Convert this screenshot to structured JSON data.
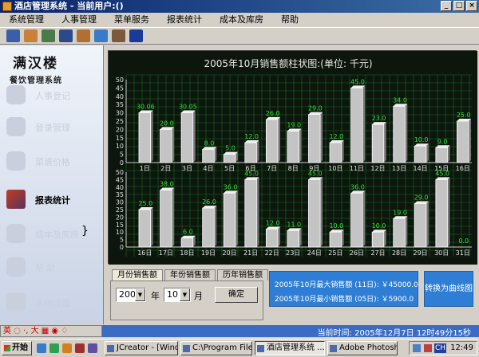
{
  "window": {
    "title": "酒店管理系统 - 当前用户:()"
  },
  "menu": [
    "系统管理",
    "人事管理",
    "菜单服务",
    "报表统计",
    "成本及库房",
    "帮助"
  ],
  "toolbar": [
    {
      "icon": "report-icon",
      "color": "#3a5fa8"
    },
    {
      "icon": "users-icon",
      "color": "#c8803a"
    },
    {
      "icon": "gear-icon",
      "color": "#4a7a4a"
    },
    {
      "icon": "book-icon",
      "color": "#2a4a8a"
    },
    {
      "icon": "folder-icon",
      "color": "#b07030"
    },
    {
      "icon": "plane-icon",
      "color": "#3a7ac8"
    },
    {
      "icon": "pen-icon",
      "color": "#7a5a3a"
    },
    {
      "icon": "info-icon",
      "color": "#1a3a9a"
    }
  ],
  "sidebar": {
    "logo_line1": "满汉楼",
    "logo_line2": "餐饮管理系统",
    "items": [
      {
        "label": "人事登记",
        "icon": "person-icon"
      },
      {
        "label": "登录管理",
        "icon": "login-icon"
      },
      {
        "label": "菜谱价格",
        "icon": "fish-icon"
      },
      {
        "label": "报表统计",
        "icon": "report-chart-icon",
        "active": true
      },
      {
        "label": "成本及库房",
        "icon": "warehouse-icon"
      },
      {
        "label": "帮 助",
        "icon": "help-icon"
      },
      {
        "label": "系统设置",
        "icon": "settings-icon"
      }
    ]
  },
  "chart_data": {
    "type": "bar",
    "title": "2005年10月销售额柱状图:(单位: 千元)",
    "ylim": [
      0,
      50
    ],
    "yticks": [
      0,
      5,
      10,
      15,
      20,
      25,
      30,
      35,
      40,
      45,
      50
    ],
    "grid": true,
    "panels": [
      {
        "categories": [
          "1日",
          "2日",
          "3日",
          "4日",
          "5日",
          "6日",
          "7日",
          "8日",
          "9日",
          "10日",
          "11日",
          "12日",
          "13日",
          "14日",
          "15日",
          "16日"
        ],
        "values": [
          30.06,
          20.0,
          30.05,
          8.0,
          5.0,
          12.0,
          26.0,
          19.0,
          29.0,
          12.0,
          45.0,
          23.0,
          34.0,
          10.0,
          9.0,
          25.0
        ],
        "labels": [
          "30.06",
          "20.0",
          "30.05",
          "8.0",
          "5.0",
          "12.0",
          "26.0",
          "19.0",
          "29.0",
          "12.0",
          "45.0",
          "23.0",
          "34.0",
          "10.0",
          "9.0",
          "25.0"
        ]
      },
      {
        "categories": [
          "16日",
          "17日",
          "18日",
          "19日",
          "20日",
          "21日",
          "22日",
          "23日",
          "24日",
          "25日",
          "26日",
          "27日",
          "28日",
          "29日",
          "30日",
          "31日"
        ],
        "values": [
          25.0,
          38.0,
          6.0,
          26.0,
          36.0,
          45.0,
          12.0,
          11.0,
          45.0,
          10.0,
          36.0,
          10.0,
          19.0,
          29.0,
          45.0,
          0.0
        ],
        "labels": [
          "25.0",
          "38.0",
          "6.0",
          "26.0",
          "36.0",
          "45.0",
          "12.0",
          "11.0",
          "45.0",
          "10.0",
          "36.0",
          "10.0",
          "19.0",
          "29.0",
          "45.0",
          "0.0"
        ]
      }
    ]
  },
  "tabs": [
    "月份销售额",
    "年份销售额",
    "历年销售额"
  ],
  "controls": {
    "year_value": "2005",
    "year_unit": "年",
    "month_value": "10",
    "month_unit": "月",
    "confirm_label": "确定"
  },
  "info": {
    "max_text": "2005年10月最大销售额 (11日): ￥45000.0",
    "min_text": "2005年10月最小销售额 (05日): ￥5900.0",
    "switch_label": "转换为曲线图"
  },
  "status": {
    "ime_text": "英 ◌ ·, 大 ▦ ◉ ♢",
    "time_text": "当前时间:  2005年12月7日  12时49分15秒"
  },
  "taskbar": {
    "start_label": "开始",
    "tasks": [
      {
        "label": "JCreator - [Wind...",
        "active": false
      },
      {
        "label": "C:\\Program Files...",
        "active": false
      },
      {
        "label": "酒店管理系统 ...",
        "active": true
      },
      {
        "label": "Adobe Photoshop",
        "active": false
      }
    ],
    "tray_lang": "CH",
    "clock": "12:49"
  },
  "colors": {
    "chart_bg": "#0c160c",
    "grid": "#1f6a2a",
    "title": "#e8e8e8",
    "bar_label": "#30e030",
    "info_bg": "#2e7ed6"
  }
}
